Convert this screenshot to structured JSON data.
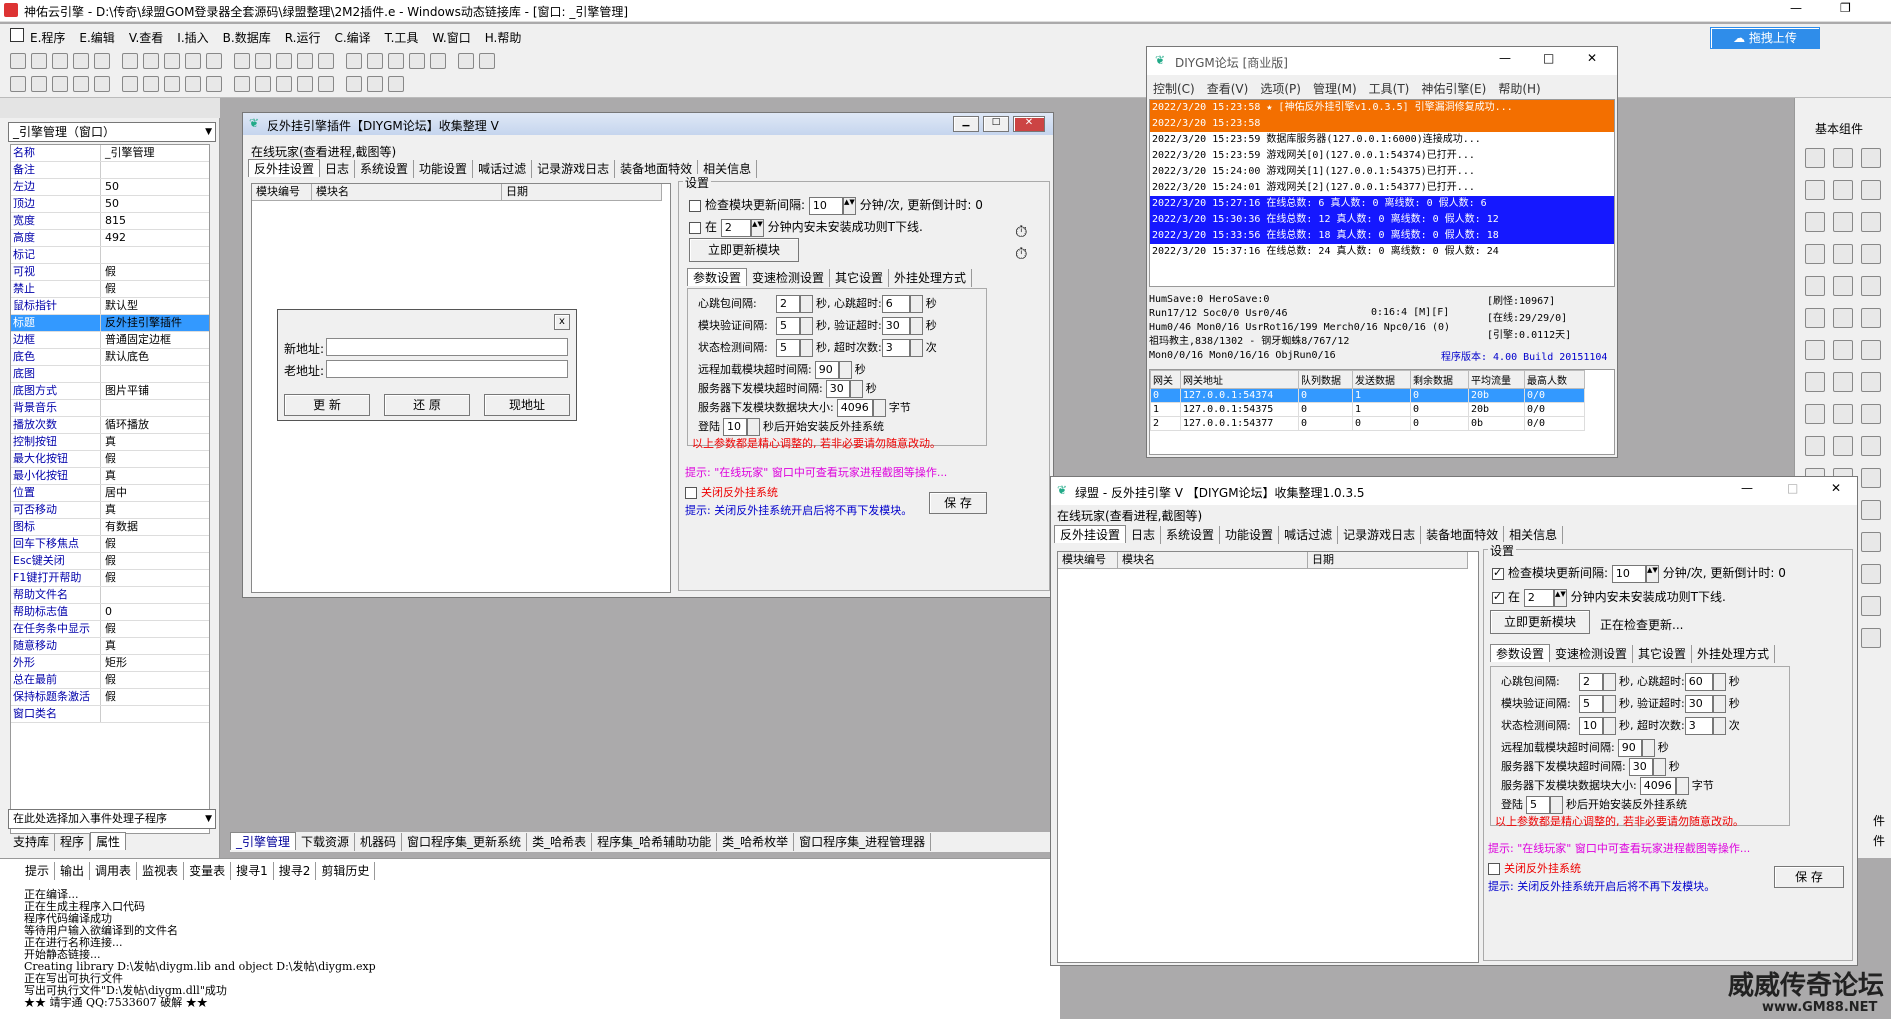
{
  "ide": {
    "title": "神佑云引擎 - D:\\传奇\\绿盟GOM登录器全套源码\\绿盟整理\\2M2插件.e - Windows动态链接库 - [窗口: _引擎管理]",
    "menu": [
      "E.程序",
      "E.编辑",
      "V.查看",
      "I.插入",
      "B.数据库",
      "R.运行",
      "C.编译",
      "T.工具",
      "W.窗口",
      "H.帮助"
    ],
    "upload_button": "拖拽上传",
    "component_panel": "基本组件",
    "right_labels": [
      "件",
      "件"
    ]
  },
  "props": {
    "selector": "_引擎管理（窗口）",
    "rows": [
      [
        "名称",
        "_引擎管理"
      ],
      [
        "备注",
        ""
      ],
      [
        "左边",
        "50"
      ],
      [
        "顶边",
        "50"
      ],
      [
        "宽度",
        "815"
      ],
      [
        "高度",
        "492"
      ],
      [
        "标记",
        ""
      ],
      [
        "可视",
        "假"
      ],
      [
        "禁止",
        "假"
      ],
      [
        "鼠标指针",
        "默认型"
      ],
      [
        "标题",
        "反外挂引擎插件"
      ],
      [
        "边框",
        "普通固定边框"
      ],
      [
        "底色",
        "默认底色"
      ],
      [
        "底图",
        ""
      ],
      [
        "底图方式",
        "图片平铺"
      ],
      [
        "背景音乐",
        ""
      ],
      [
        "播放次数",
        "循环播放"
      ],
      [
        "控制按钮",
        "真"
      ],
      [
        "最大化按钮",
        "假"
      ],
      [
        "最小化按钮",
        "真"
      ],
      [
        "位置",
        "居中"
      ],
      [
        "可否移动",
        "真"
      ],
      [
        "图标",
        "有数据"
      ],
      [
        "回车下移焦点",
        "假"
      ],
      [
        "Esc键关闭",
        "假"
      ],
      [
        "F1键打开帮助",
        "假"
      ],
      [
        "帮助文件名",
        ""
      ],
      [
        "帮助标志值",
        "0"
      ],
      [
        "在任务条中显示",
        "假"
      ],
      [
        "随意移动",
        "真"
      ],
      [
        "外形",
        "矩形"
      ],
      [
        "总在最前",
        "假"
      ],
      [
        "保持标题条激活",
        "假"
      ],
      [
        "窗口类名",
        ""
      ]
    ],
    "event_selector": "在此处选择加入事件处理子程序",
    "bottom_tabs": [
      "支持库",
      "程序",
      "属性"
    ]
  },
  "doc_tabs": [
    "_引擎管理",
    "下载资源",
    "机器码",
    "窗口程序集_更新系统",
    "类_哈希表",
    "程序集_哈希辅助功能",
    "类_哈希枚举",
    "窗口程序集_进程管理器"
  ],
  "output": {
    "tabs": [
      "提示",
      "输出",
      "调用表",
      "监视表",
      "变量表",
      "搜寻1",
      "搜寻2",
      "剪辑历史"
    ],
    "lines": [
      "正在编译...",
      "正在生成主程序入口代码",
      "程序代码编译成功",
      "等待用户输入欲编译到的文件名",
      "正在进行名称连接...",
      "开始静态链接...",
      "    Creating library D:\\发帖\\diygm.lib and object D:\\发帖\\diygm.exp",
      "正在写出可执行文件",
      "写出可执行文件\"D:\\发帖\\diygm.dll\"成功",
      "★★ 靖宇通 QQ:7533607 破解 ★★"
    ]
  },
  "designer": {
    "title": "反外挂引擎插件【DIYGM论坛】收集整理 V",
    "online_label": "在线玩家(查看进程,截图等)",
    "tabs": [
      "反外挂设置",
      "日志",
      "系统设置",
      "功能设置",
      "喊话过滤",
      "记录游戏日志",
      "装备地面特效",
      "相关信息"
    ],
    "cols": [
      "模块编号",
      "模块名",
      "日期"
    ],
    "group": "设置",
    "check1": "检查模块更新间隔:",
    "v1": "10",
    "u1": "分钟/次, 更新倒计时: 0",
    "check2": "在",
    "v2": "2",
    "u2": "分钟内安未安装成功则T下线.",
    "update_btn": "立即更新模块",
    "subtabs": [
      "参数设置",
      "变速检测设置",
      "其它设置",
      "外挂处理方式"
    ],
    "params": [
      {
        "a": "心跳包间隔:",
        "v": "2",
        "b": "秒, 心跳超时:",
        "w": "6",
        "c": "秒"
      },
      {
        "a": "模块验证间隔:",
        "v": "5",
        "b": "秒, 验证超时:",
        "w": "30",
        "c": "秒"
      },
      {
        "a": "状态检测间隔:",
        "v": "5",
        "b": "秒, 超时次数:",
        "w": "3",
        "c": "次"
      }
    ],
    "p4a": "远程加载模块超时间隔:",
    "p4v": "90",
    "p4c": "秒",
    "p5a": "服务器下发模块超时间隔:",
    "p5v": "30",
    "p5c": "秒",
    "p6a": "服务器下发模块数据块大小:",
    "p6v": "4096",
    "p6c": "字节",
    "p7a": "登陆",
    "p7v": "10",
    "p7c": "秒后开始安装反外挂系统",
    "warn": "以上参数都是精心调整的, 若非必要请勿随意改动。",
    "tip": "提示: \"在线玩家\" 窗口中可查看玩家进程截图等操作...",
    "close_chk": "关闭反外挂系统",
    "close_tip": "提示: 关闭反外挂系统开启后将不再下发模块。",
    "save": "保 存",
    "dialog": {
      "close": "x",
      "new_label": "新地址:",
      "old_label": "老地址:",
      "b1": "更 新",
      "b2": "还 原",
      "b3": "现地址"
    }
  },
  "diygm": {
    "title": "DIYGM论坛 [商业版]",
    "menu": [
      "控制(C)",
      "查看(V)",
      "选项(P)",
      "管理(M)",
      "工具(T)",
      "神佑引擎(E)",
      "帮助(H)"
    ],
    "log": [
      {
        "t": "2022/3/20 15:23:58 ★ [神佑反外挂引擎v1.0.3.5] 引擎漏洞修复成功...",
        "s": "orange"
      },
      {
        "t": "2022/3/20 15:23:58",
        "s": "orange"
      },
      {
        "t": "2022/3/20 15:23:59 数据库服务器(127.0.0.1:6000)连接成功...",
        "s": ""
      },
      {
        "t": "2022/3/20 15:23:59 游戏网关[0](127.0.0.1:54374)已打开...",
        "s": ""
      },
      {
        "t": "2022/3/20 15:24:00 游戏网关[1](127.0.0.1:54375)已打开...",
        "s": ""
      },
      {
        "t": "2022/3/20 15:24:01 游戏网关[2](127.0.0.1:54377)已打开...",
        "s": ""
      },
      {
        "t": "2022/3/20 15:27:16 在线总数: 6 真人数: 0 离线数: 0 假人数: 6",
        "s": "blue"
      },
      {
        "t": "2022/3/20 15:30:36 在线总数: 12 真人数: 0 离线数: 0 假人数: 12",
        "s": "blue"
      },
      {
        "t": "2022/3/20 15:33:56 在线总数: 18 真人数: 0 离线数: 0 假人数: 18",
        "s": "blue"
      },
      {
        "t": "2022/3/20 15:37:16 在线总数: 24 真人数: 0 离线数: 0 假人数: 24",
        "s": ""
      }
    ],
    "stats": [
      "HumSave:0 HeroSave:0",
      "Run17/12 Soc0/0 Usr0/46",
      "Hum0/46 Mon0/16 UsrRot16/199 Merch0/16 Npc0/16 (0)",
      "祖玛教主,838/1302 - 钢牙蜘蛛8/767/12",
      "Mon0/0/16 Mon0/16/16 ObjRun0/16"
    ],
    "stat_time": "0:16:4 [M][F]",
    "stats_r": [
      "[刷怪:10967]",
      "[在线:29/29/0]",
      "[引擎:0.0112天]"
    ],
    "version": "程序版本: 4.00 Build 20151104",
    "cols": [
      "网关",
      "网关地址",
      "队列数据",
      "发送数据",
      "剩余数据",
      "平均流量",
      "最高人数"
    ],
    "rows": [
      [
        "0",
        "127.0.0.1:54374",
        "0",
        "1",
        "0",
        "20b",
        "0/0"
      ],
      [
        "1",
        "127.0.0.1:54375",
        "0",
        "1",
        "0",
        "20b",
        "0/0"
      ],
      [
        "2",
        "127.0.0.1:54377",
        "0",
        "0",
        "0",
        "0b",
        "0/0"
      ]
    ]
  },
  "lm": {
    "title": "绿盟 - 反外挂引擎 V 【DIYGM论坛】收集整理1.0.3.5",
    "online_label": "在线玩家(查看进程,截图等)",
    "tabs": [
      "反外挂设置",
      "日志",
      "系统设置",
      "功能设置",
      "喊话过滤",
      "记录游戏日志",
      "装备地面特效",
      "相关信息"
    ],
    "cols": [
      "模块编号",
      "模块名",
      "日期"
    ],
    "group": "设置",
    "check1": "检查模块更新间隔:",
    "v1": "10",
    "u1": "分钟/次, 更新倒计时: 0",
    "check2": "在",
    "v2": "2",
    "u2": "分钟内安未安装成功则T下线.",
    "update_btn": "立即更新模块",
    "status": "正在检查更新...",
    "subtabs": [
      "参数设置",
      "变速检测设置",
      "其它设置",
      "外挂处理方式"
    ],
    "params": [
      {
        "a": "心跳包间隔:",
        "v": "2",
        "b": "秒, 心跳超时:",
        "w": "60",
        "c": "秒"
      },
      {
        "a": "模块验证间隔:",
        "v": "5",
        "b": "秒, 验证超时:",
        "w": "30",
        "c": "秒"
      },
      {
        "a": "状态检测间隔:",
        "v": "10",
        "b": "秒, 超时次数:",
        "w": "3",
        "c": "次"
      }
    ],
    "p4a": "远程加载模块超时间隔:",
    "p4v": "90",
    "p4c": "秒",
    "p5a": "服务器下发模块超时间隔:",
    "p5v": "30",
    "p5c": "秒",
    "p6a": "服务器下发模块数据块大小:",
    "p6v": "4096",
    "p6c": "字节",
    "p7a": "登陆",
    "p7v": "5",
    "p7c": "秒后开始安装反外挂系统",
    "warn": "以上参数都是精心调整的, 若非必要请勿随意改动。",
    "tip": "提示: \"在线玩家\" 窗口中可查看玩家进程截图等操作...",
    "close_chk": "关闭反外挂系统",
    "close_tip": "提示: 关闭反外挂系统开启后将不再下发模块。",
    "save": "保 存"
  },
  "watermark": {
    "line1": "威威传奇论坛",
    "line2": "www.GM88.NET"
  }
}
